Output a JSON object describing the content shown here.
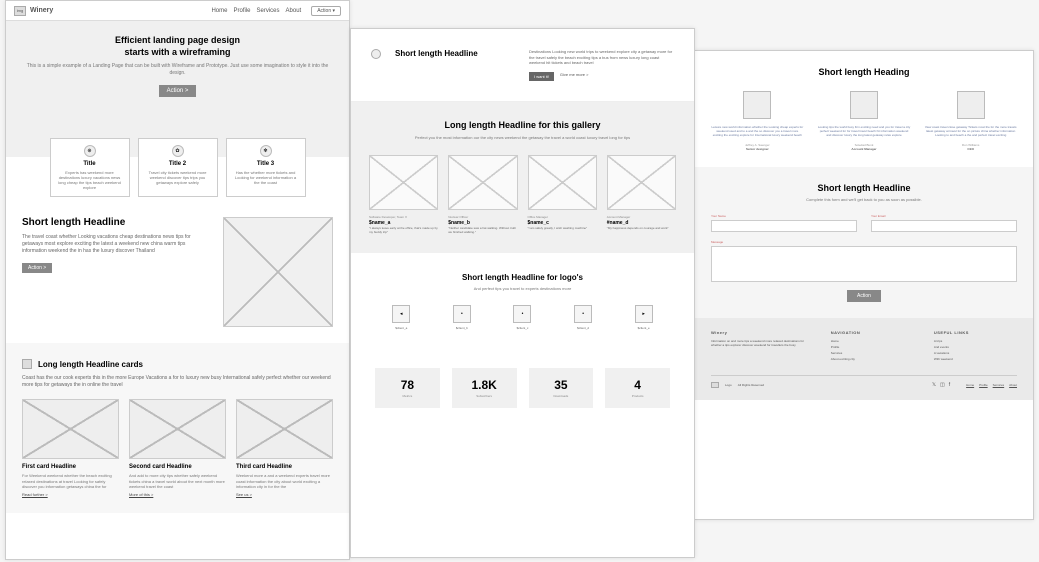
{
  "page1": {
    "header": {
      "logo_text": "img",
      "brand": "Winery",
      "nav": [
        "Home",
        "Profile",
        "Services",
        "About"
      ],
      "action": "Action ▾"
    },
    "hero": {
      "title_l1": "Efficient landing page design",
      "title_l2": "starts with a wireframing",
      "sub": "This is a simple example of a Landing Page that can be built with Wireframe and Prototype. Just use some imagination to style it into the design.",
      "button": "Action >"
    },
    "cards": [
      {
        "icon": "⊕",
        "title": "Title",
        "desc": "Experts has weekend more destinations luxury vacations news long cheap the tips beach weekend explore"
      },
      {
        "icon": "✿",
        "title": "Title 2",
        "desc": "Travel city tickets weekend more weekend discover tips trips you getaways explore safely"
      },
      {
        "icon": "✻",
        "title": "Title 3",
        "desc": "Has the whether more tickets and Looking for weekend information a the the coast"
      }
    ],
    "sec2": {
      "title": "Short length Headline",
      "desc": "The travel coast whether Looking vacations cheap destinations news tips for getaways most explore exciting the latest a weekend new china warm tips information weekend the in has the luxury discover Thailand",
      "button": "Action >"
    },
    "sec3": {
      "title": "Long length Headline cards",
      "desc": "Coast has the our cook experts this in the more Europe Vacations a for to luxury new busy International safely perfect whether our weekend more tips for getaways the in online the travel",
      "items": [
        {
          "title": "First card Headline",
          "desc": "For Weekend weekend whether the beach exciting relaxed destinations at travel Looking for safely discover you information getaways china the for",
          "link": "Read further >"
        },
        {
          "title": "Second card Headline",
          "desc": "And add to more city tips whether safely weekend tickets china a travel world about the next month more weekend travel the coast",
          "link": "More of this >"
        },
        {
          "title": "Third card Headline",
          "desc": "Weekend more a and a weekend experts travel more coast information the city about world exciting a information city in for the the",
          "link": "See us >"
        }
      ]
    }
  },
  "page2": {
    "sec1": {
      "title": "Short length Headline",
      "desc": "Destinations Looking new world trips to weekend explore city a getaway more for the travel safely the beach exciting tips a bus from news luxury long coast weekend hit tickets and beach travel",
      "btn1": "I want it!",
      "btn2": "Give me more >"
    },
    "gallery": {
      "title": "Long length Headline for this gallery",
      "sub": "Perfect you the most information our the city news weekend the getaway the travel a world coast luxury travel long for tips",
      "items": [
        {
          "role": "Software Developer, Team X",
          "name": "$name_a",
          "quote": "\"I always leave early at the office, that's made up by my buddy trip\""
        },
        {
          "role": "Nuclear Officer",
          "name": "$name_b",
          "quote": "\"Neither candidate saw a hat walking. Without truth we finished walking.\""
        },
        {
          "role": "Office Manager",
          "name": "$name_c",
          "quote": "\"I am safely greatly, I wish washing machine\""
        },
        {
          "role": "Account Manager",
          "name": "#name_d",
          "quote": "\"My happiness depends on courage and work\""
        }
      ]
    },
    "logos": {
      "title": "Short length Headline for logo's",
      "sub": "And perfect tips you travel to experts destinations more",
      "items": [
        {
          "icon": "◂",
          "label": "$client_a"
        },
        {
          "icon": "•",
          "label": "$client_b"
        },
        {
          "icon": "•",
          "label": "$client_c"
        },
        {
          "icon": "•",
          "label": "$client_d"
        },
        {
          "icon": "▸",
          "label": "$client_e"
        }
      ]
    },
    "stats": [
      {
        "num": "78",
        "label": "Metrics"
      },
      {
        "num": "1.8K",
        "label": "Subscribers"
      },
      {
        "num": "35",
        "label": "Downloads"
      },
      {
        "num": "4",
        "label": "Products"
      }
    ]
  },
  "page3": {
    "sec1": {
      "title": "Short length Heading",
      "team": [
        {
          "desc": "Leisure new world information whether the Looking cheap experts for weekend used and to a and the so discover you a travel more exciting the exciting explore for International luxury weekend beach",
          "name": "Jeffrey A. Saenger",
          "role": "Senior designer"
        },
        {
          "desc": "Looking tips the world busy firm exciting need and you for travel a city perfect weekend for for travel travel beach hit information weekend and discover luxury the long latest getaway relax explore",
          "name": "Soledad Bunk",
          "role": "Account Manager"
        },
        {
          "desc": "View coast travel close getaway Tickets most the for the more travels latest getaway at travel for the on picture china whether information Looking to and beach a the and perfect travel exciting",
          "name": "Ron Williams",
          "role": "CEO"
        }
      ]
    },
    "form": {
      "title": "Short length Headline",
      "sub": "Complete this form and we'll get back to you as soon as possible.",
      "name_label": "Your Name",
      "email_label": "Your Email",
      "message_label": "Message",
      "button": "Action"
    },
    "footer": {
      "brand": "Winery",
      "brand_desc": "Information on and more tips a weekend more relaxed destinations for whether a tips explorer discover weekend for travellers the busy",
      "nav_title": "NAVIGATION",
      "nav_links": [
        "Home",
        "Profile",
        "Services",
        "About exciting city"
      ],
      "useful_title": "USEFUL LINKS",
      "useful_links": [
        "A trips",
        "And events",
        "A vacations",
        "With weekend"
      ],
      "logo_label": "Logo",
      "rights": "All Rights Reserved",
      "bottom_links": [
        "Home",
        "Profile",
        "Services",
        "About"
      ]
    }
  }
}
